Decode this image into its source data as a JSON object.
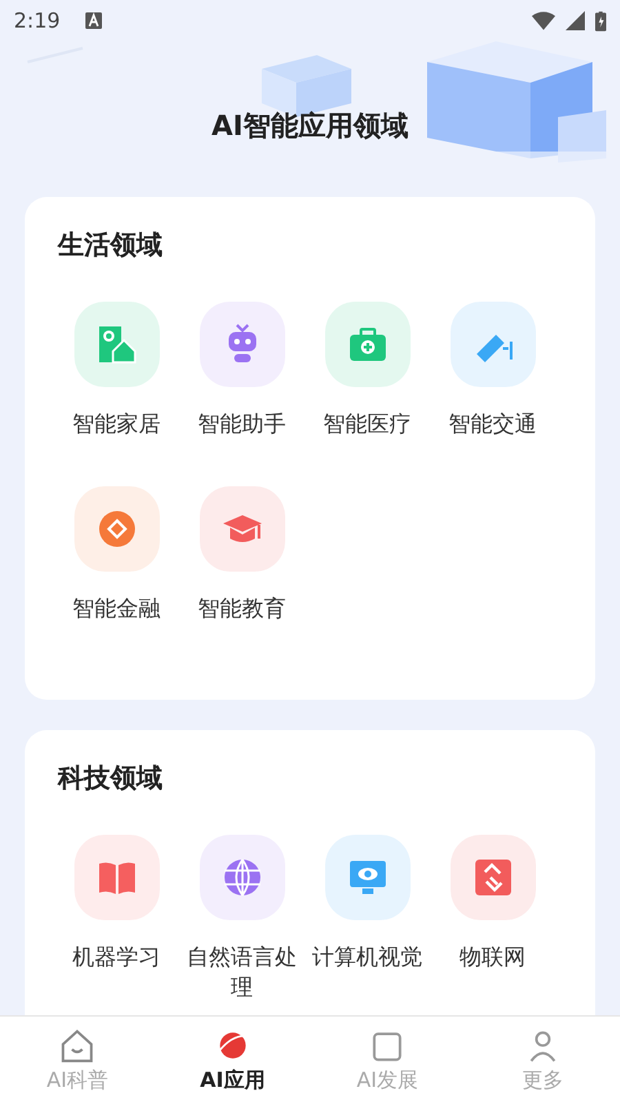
{
  "status_bar": {
    "time": "2:19"
  },
  "header": {
    "title": "AI智能应用领域"
  },
  "sections": [
    {
      "title": "生活领域",
      "items": [
        {
          "label": "智能家居",
          "kind": "home",
          "color": "#1fc77e"
        },
        {
          "label": "智能助手",
          "kind": "robot",
          "color": "#9b72f2"
        },
        {
          "label": "智能医疗",
          "kind": "medkit",
          "color": "#1fc77e"
        },
        {
          "label": "智能交通",
          "kind": "camera",
          "color": "#3aa8f5"
        },
        {
          "label": "智能金融",
          "kind": "coin",
          "color": "#f5793a"
        },
        {
          "label": "智能教育",
          "kind": "cap",
          "color": "#f25c5c"
        }
      ]
    },
    {
      "title": "科技领域",
      "items": [
        {
          "label": "机器学习",
          "kind": "book",
          "color": "#f55f5f"
        },
        {
          "label": "自然语言处理",
          "kind": "globe",
          "color": "#9b72f2"
        },
        {
          "label": "计算机视觉",
          "kind": "monitor",
          "color": "#3aa8f5"
        },
        {
          "label": "物联网",
          "kind": "link",
          "color": "#f25c5c"
        }
      ]
    }
  ],
  "nav": [
    {
      "label": "AI科普",
      "kind": "house",
      "selected": false
    },
    {
      "label": "AI应用",
      "kind": "planet",
      "selected": true
    },
    {
      "label": "AI发展",
      "kind": "cube",
      "selected": false
    },
    {
      "label": "更多",
      "kind": "more",
      "selected": false
    }
  ]
}
